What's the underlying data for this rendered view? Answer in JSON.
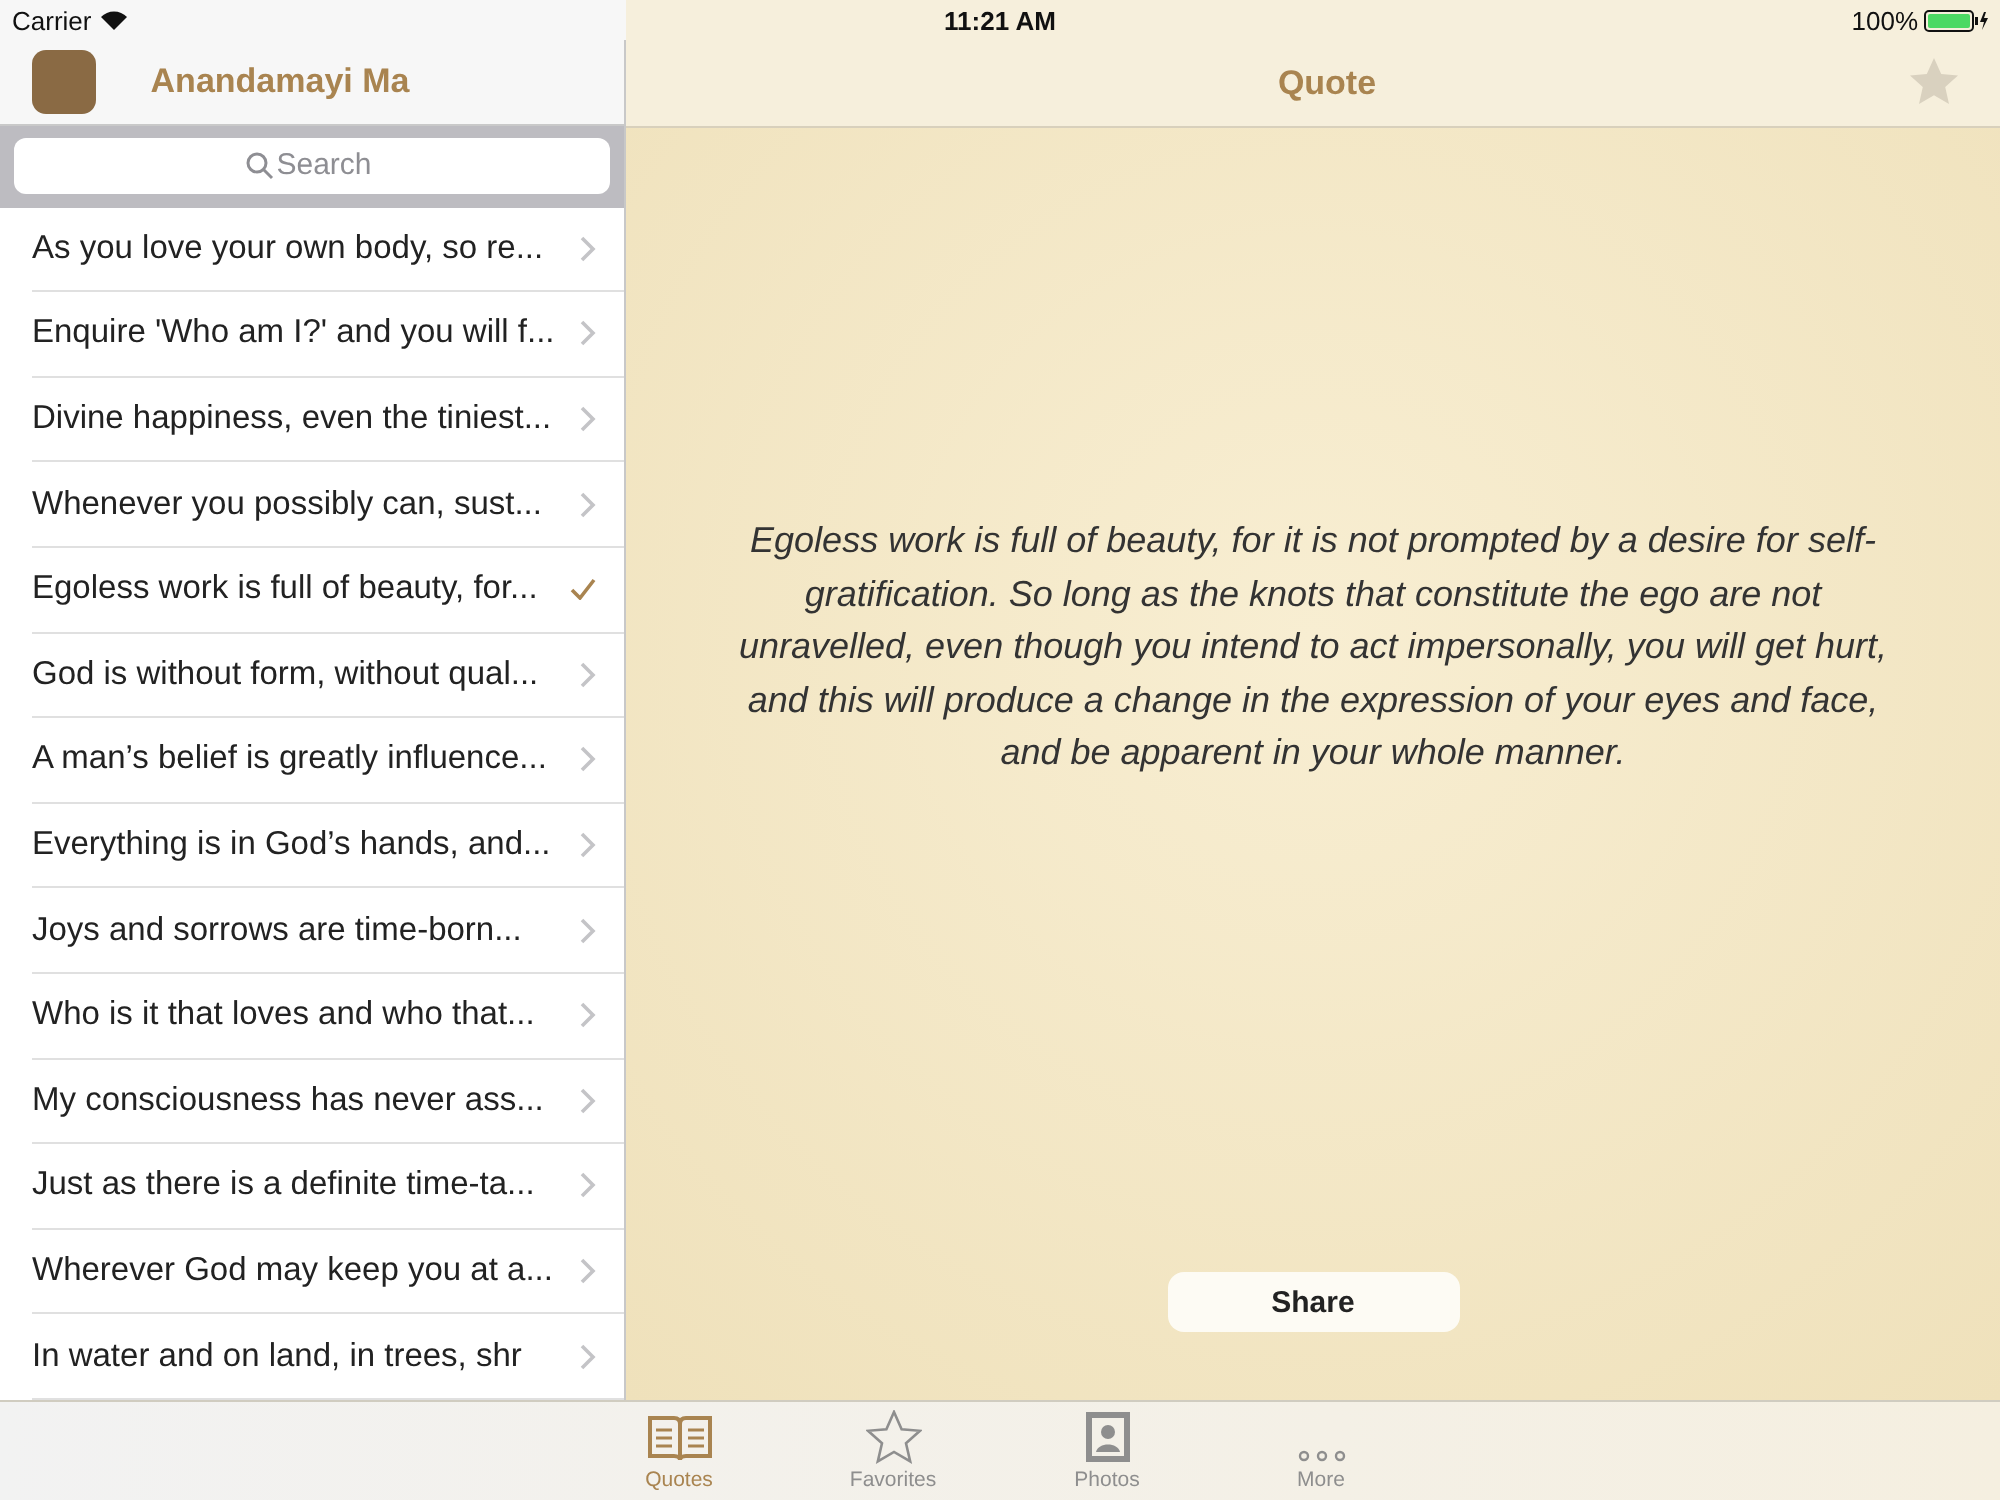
{
  "status_bar": {
    "carrier": "Carrier",
    "time": "11:21 AM",
    "battery": "100%"
  },
  "sidebar": {
    "title": "Anandamayi Ma",
    "search": {
      "placeholder": "Search"
    },
    "items": [
      {
        "text": "As you love your own body, so re...",
        "selected": false
      },
      {
        "text": "Enquire 'Who am I?' and you will f...",
        "selected": false
      },
      {
        "text": "Divine happiness, even the tiniest...",
        "selected": false
      },
      {
        "text": "Whenever you possibly can, sust...",
        "selected": false
      },
      {
        "text": "Egoless work is full of beauty, for...",
        "selected": true
      },
      {
        "text": "God is without form, without qual...",
        "selected": false
      },
      {
        "text": "A man’s belief is greatly influence...",
        "selected": false
      },
      {
        "text": "Everything is in God’s hands, and...",
        "selected": false
      },
      {
        "text": "Joys and sorrows are time-born...",
        "selected": false
      },
      {
        "text": "Who is it that loves and who that...",
        "selected": false
      },
      {
        "text": "My consciousness has never ass...",
        "selected": false
      },
      {
        "text": "Just as there is a definite time-ta...",
        "selected": false
      },
      {
        "text": "Wherever God may keep you at a...",
        "selected": false
      },
      {
        "text": "In water and on land, in trees, shr",
        "selected": false
      }
    ]
  },
  "detail": {
    "title": "Quote",
    "quote": "Egoless work is full of beauty, for it is not prompted by a desire for self-gratification. So long as the knots that constitute the ego are not unravelled, even though you intend to act impersonally, you will get hurt, and this will produce a change in the expression of your eyes and face, and be apparent in your whole manner.",
    "share": "Share"
  },
  "tab_bar": [
    {
      "kind": "book",
      "label": "Quotes",
      "selected": true
    },
    {
      "kind": "star",
      "label": "Favorites",
      "selected": false
    },
    {
      "kind": "photo",
      "label": "Photos",
      "selected": false
    },
    {
      "kind": "more",
      "label": "More",
      "selected": false
    }
  ]
}
